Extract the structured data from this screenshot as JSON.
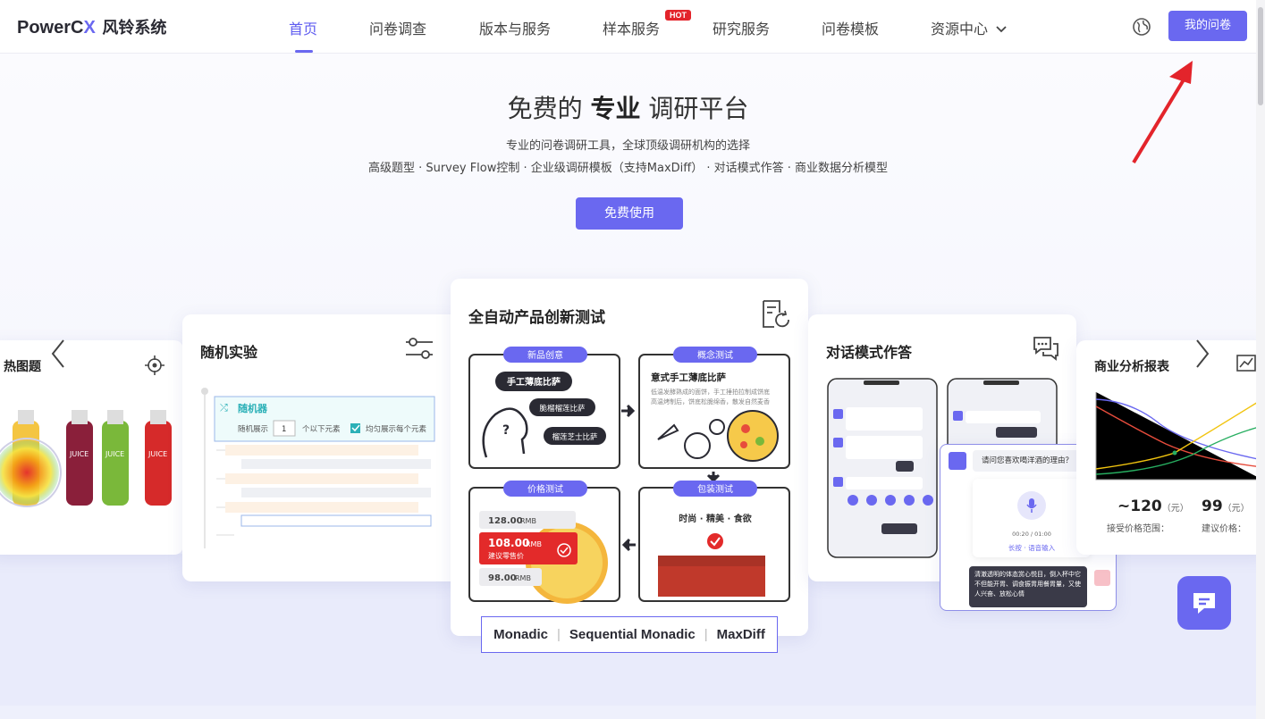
{
  "nav": {
    "logo_brand": "PowerC",
    "logo_x": "X",
    "logo_cn": "风铃系统",
    "items": [
      {
        "label": "首页",
        "active": true
      },
      {
        "label": "问卷调查"
      },
      {
        "label": "版本与服务"
      },
      {
        "label": "样本服务",
        "badge": "HOT"
      },
      {
        "label": "研究服务"
      },
      {
        "label": "问卷模板"
      },
      {
        "label": "资源中心"
      }
    ],
    "my_survey": "我的问卷"
  },
  "hero": {
    "title_pre": "免费的",
    "title_bold": "专业",
    "title_post": "调研平台",
    "subtitle1": "专业的问卷调研工具，全球顶级调研机构的选择",
    "subtitle2": "高级题型 · Survey Flow控制 · 企业级调研模板（支持MaxDiff） · 对话模式作答 · 商业数据分析模型",
    "cta": "免费使用"
  },
  "cards": {
    "heatmap": {
      "title": "热图题",
      "bottle_text": "JUICE"
    },
    "random": {
      "title": "随机实验",
      "randomizer": "随机器",
      "show": "随机展示",
      "count": "1",
      "unit": "个以下元素",
      "even": "均匀展示每个元素"
    },
    "auto": {
      "title": "全自动产品创新测试",
      "q1_tag": "新品创意",
      "q1_b1": "手工薄底比萨",
      "q1_b2": "脆榴榴莲比萨",
      "q1_b3": "榴莲芝士比萨",
      "q2_tag": "概念测试",
      "q2_title": "意式手工薄底比萨",
      "q2_line1": "低温发酵熟成的面饼，手工捶拍拉制成饼底",
      "q2_line2": "高温烤制后，饼底松脆绵香，散发自然麦香",
      "q3_tag": "价格测试",
      "p1": "128.00",
      "p2": "108.00",
      "p3": "98.00",
      "rmb": "RMB",
      "suggest": "建议零售价",
      "q4_tag": "包装测试",
      "q4_text": "时尚 · 精美 · 食欲",
      "methods": [
        "Monadic",
        "Sequential Monadic",
        "MaxDiff"
      ]
    },
    "chat": {
      "title": "对话模式作答",
      "question": "请问您喜欢喝洋酒的理由？",
      "timer": "00:20 / 01:00",
      "voice": "长按 · 语音输入",
      "answer": "清澈透明的体态赏心悦目，倒入杯中它不但能开胃、调食振胃用餐胃量，又使人兴奋、放松心情"
    },
    "biz": {
      "title": "商业分析报表",
      "range": "~120",
      "range_unit": "（元）",
      "range_label": "接受价格范围：",
      "suggest": "99",
      "suggest_unit": "（元）",
      "suggest_label": "建议价格："
    }
  },
  "colors": {
    "accent": "#6a68f0",
    "hot": "#e3242b",
    "price_red": "#e32a2a"
  }
}
